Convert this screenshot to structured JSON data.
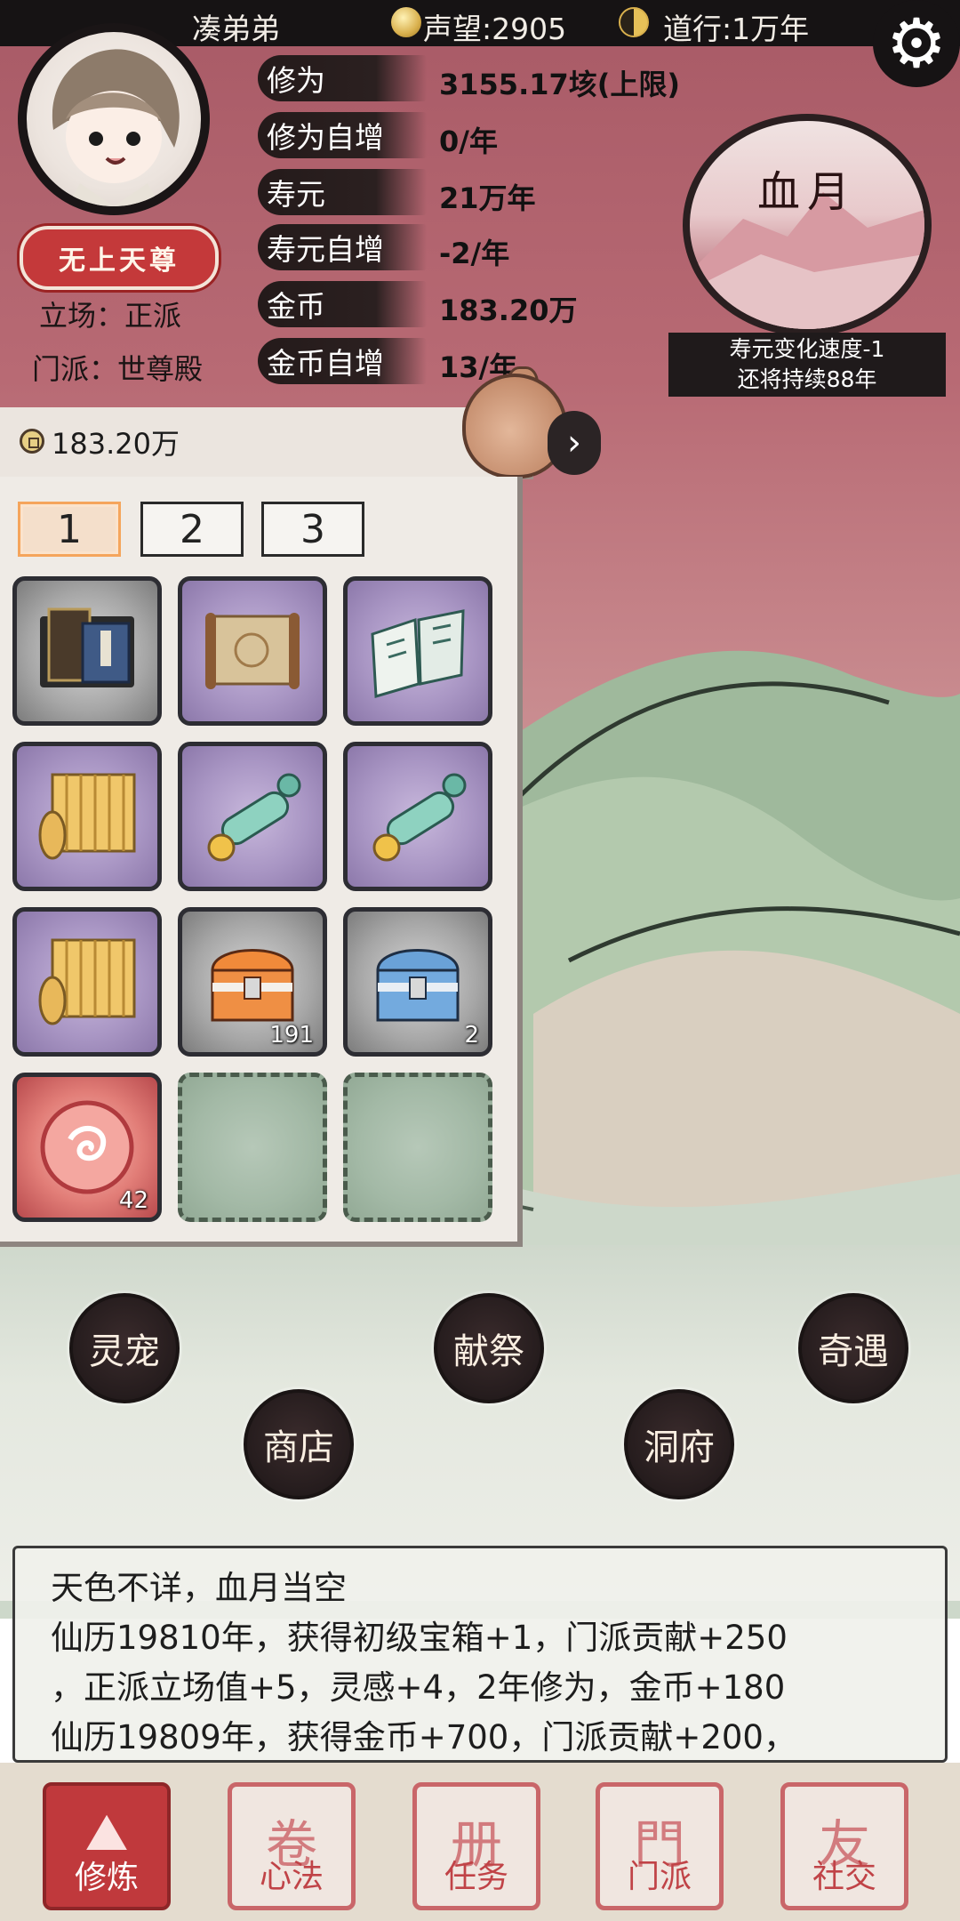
{
  "header": {
    "player_name": "凑弟弟",
    "reputation_text": "声望:2905",
    "daoxing_text": "道行:1万年"
  },
  "profile": {
    "title_badge": "无上天尊",
    "stance": "立场：正派",
    "sect": "门派：世尊殿"
  },
  "stats": [
    {
      "label": "修为",
      "value": "3155.17垓(上限)"
    },
    {
      "label": "修为自增",
      "value": "0/年"
    },
    {
      "label": "寿元",
      "value": "21万年"
    },
    {
      "label": "寿元自增",
      "value": "-2/年"
    },
    {
      "label": "金币",
      "value": "183.20万"
    },
    {
      "label": "金币自增",
      "value": "13/年"
    }
  ],
  "event": {
    "name": "血月",
    "info_line1": "寿元变化速度-1",
    "info_line2": "还将持续88年"
  },
  "inventory": {
    "gold": "183.20万",
    "tabs": [
      "1",
      "2",
      "3"
    ],
    "active_tab": 0,
    "slots": [
      {
        "item": "book-box",
        "quantity": ""
      },
      {
        "item": "scroll-map",
        "quantity": ""
      },
      {
        "item": "open-book",
        "quantity": ""
      },
      {
        "item": "bamboo-scroll",
        "quantity": ""
      },
      {
        "item": "jade-scroll",
        "quantity": ""
      },
      {
        "item": "jade-scroll",
        "quantity": ""
      },
      {
        "item": "bamboo-scroll",
        "quantity": ""
      },
      {
        "item": "orange-chest",
        "quantity": "191"
      },
      {
        "item": "blue-chest",
        "quantity": "2"
      },
      {
        "item": "swirl-orb",
        "quantity": "42"
      },
      {
        "item": "empty",
        "quantity": ""
      },
      {
        "item": "empty",
        "quantity": ""
      }
    ]
  },
  "actions": {
    "pet": "灵宠",
    "offering": "献祭",
    "encounter": "奇遇",
    "shop": "商店",
    "cave": "洞府"
  },
  "log": [
    "天色不详，血月当空",
    "仙历19810年，获得初级宝箱+1，门派贡献+250",
    "，正派立场值+5，灵感+4，2年修为，金币+180",
    "仙历19809年，获得金币+700，门派贡献+200，"
  ],
  "nav": [
    {
      "label": "修炼",
      "glyph": "⛰",
      "active": true
    },
    {
      "label": "心法",
      "glyph": "卷",
      "active": false
    },
    {
      "label": "任务",
      "glyph": "册",
      "active": false
    },
    {
      "label": "门派",
      "glyph": "門",
      "active": false
    },
    {
      "label": "社交",
      "glyph": "友",
      "active": false
    }
  ],
  "colors": {
    "accent_red": "#c0393c",
    "sky": "#b86a74",
    "panel": "#efebe6"
  }
}
